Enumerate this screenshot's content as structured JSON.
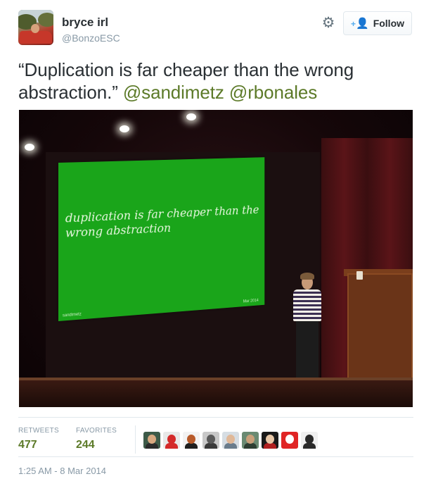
{
  "user": {
    "name": "bryce irl",
    "handle": "@BonzoESC"
  },
  "follow_button": {
    "label": "Follow"
  },
  "tweet": {
    "text": "“Duplication is far cheaper than the wrong abstraction.” ",
    "mentions": [
      "@sandimetz",
      "@rbonales"
    ]
  },
  "photo": {
    "slide_text": "duplication is far cheaper than the wrong abstraction",
    "slide_footer_left": "sandimetz",
    "slide_footer_right": "Mar 2014"
  },
  "stats": {
    "retweets_label": "RETWEETS",
    "retweets_value": "477",
    "favorites_label": "FAVORITES",
    "favorites_value": "244"
  },
  "favoriters": [
    {
      "name": "favoriter-avatar-1",
      "bg": "#3d5a48",
      "head": "#d8a880",
      "body": "#2b2b2b"
    },
    {
      "name": "favoriter-avatar-2",
      "bg": "#e8e8e8",
      "head": "#d42a2a",
      "body": "#d42a2a"
    },
    {
      "name": "favoriter-avatar-3",
      "bg": "#f2f2f2",
      "head": "#b85a2a",
      "body": "#1e1e1e"
    },
    {
      "name": "favoriter-avatar-4",
      "bg": "#c8c8c8",
      "head": "#5a5a5a",
      "body": "#3a3a3a"
    },
    {
      "name": "favoriter-avatar-5",
      "bg": "#d6dde3",
      "head": "#e0b898",
      "body": "#6a7c8c"
    },
    {
      "name": "favoriter-avatar-6",
      "bg": "#6a8a72",
      "head": "#c9a07a",
      "body": "#2e3e32"
    },
    {
      "name": "favoriter-avatar-7",
      "bg": "#1a1a1a",
      "head": "#e8c8a8",
      "body": "#b02020"
    },
    {
      "name": "favoriter-avatar-8",
      "bg": "#e02424",
      "head": "#ffffff",
      "body": "#e02424"
    },
    {
      "name": "favoriter-avatar-9",
      "bg": "#f0f0f0",
      "head": "#2a2a2a",
      "body": "#2a2a2a"
    }
  ],
  "timestamp": "1:25 AM - 8 Mar 2014",
  "colors": {
    "mention": "#5c7a28",
    "stat_value": "#5c7a28",
    "follow_icon": "#55acee",
    "muted": "#8899a6"
  },
  "icons": [
    "gear-icon",
    "follow-person-icon"
  ]
}
